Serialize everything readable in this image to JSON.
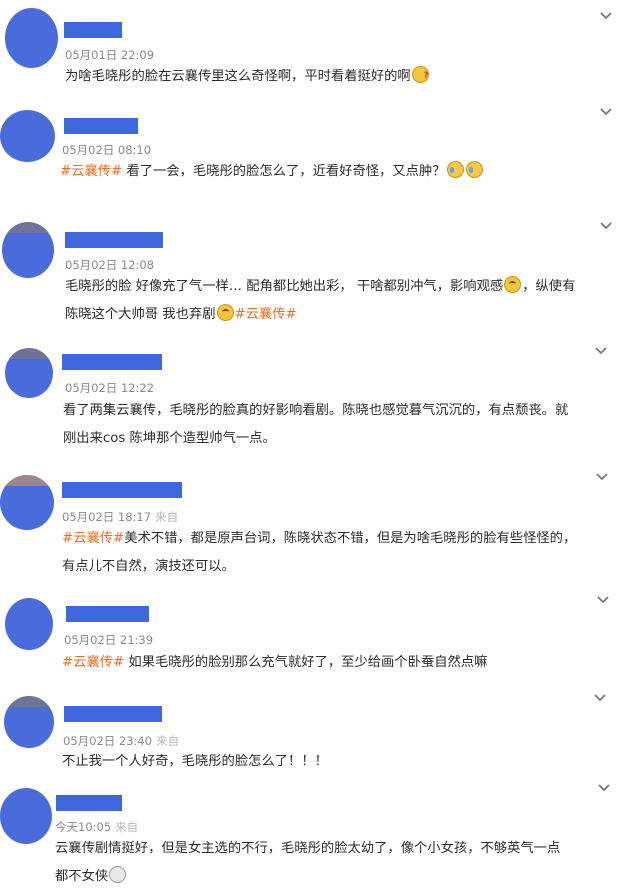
{
  "comments": [
    {
      "time": "05月01日 22:09",
      "source": "",
      "lines": [
        [
          {
            "t": "为啥毛晓彤的脸在云襄传里这么奇怪啊，平时看着挺好的啊"
          },
          {
            "emoji": "confused-face"
          }
        ]
      ]
    },
    {
      "time": "05月02日 08:10",
      "source": "",
      "lines": [
        [
          {
            "t": "#云襄传#",
            "tag": true
          },
          {
            "t": " 看了一会，毛晓彤的脸怎么了，近看好奇怪，又点肿？"
          },
          {
            "emoji": "crying-laughing-face"
          },
          {
            "emoji": "crying-laughing-face"
          }
        ]
      ]
    },
    {
      "time": "05月02日 12:08",
      "source": "",
      "lines": [
        [
          {
            "t": "毛晓彤的脸 好像充了气一样… 配角都比她出彩， 干啥都别冲气，影响观感"
          },
          {
            "emoji": "frowning-face"
          },
          {
            "t": "，纵使有"
          }
        ],
        [
          {
            "t": "陈晓这个大帅哥 我也弃剧"
          },
          {
            "emoji": "frowning-face"
          },
          {
            "t": "#云襄传#",
            "tag": true
          }
        ]
      ]
    },
    {
      "time": "05月02日 12:22",
      "source": "",
      "lines": [
        [
          {
            "t": "看了两集云襄传，毛晓彤的脸真的好影响看剧。陈晓也感觉暮气沉沉的，有点颓丧。就"
          }
        ],
        [
          {
            "t": "刚出来cos 陈坤那个造型帅气一点。"
          }
        ]
      ]
    },
    {
      "time": "05月02日 18:17",
      "source": "来自",
      "lines": [
        [
          {
            "t": "#云襄传#",
            "tag": true
          },
          {
            "t": "美术不错，都是原声台词，陈晓状态不错，但是为啥毛晓彤的脸有些怪怪的，"
          }
        ],
        [
          {
            "t": "有点儿不自然，演技还可以。"
          }
        ]
      ]
    },
    {
      "time": "05月02日 21:39",
      "source": "",
      "lines": [
        [
          {
            "t": "#云襄传#",
            "tag": true
          },
          {
            "t": " 如果毛晓彤的脸别那么充气就好了，至少给画个卧蚕自然点嘛"
          }
        ]
      ]
    },
    {
      "time": "05月02日 23:40",
      "source": "来自",
      "lines": [
        [
          {
            "t": "不止我一个人好奇，毛晓彤的脸怎么了！！！"
          }
        ]
      ]
    },
    {
      "time": "今天10:05",
      "source": "来自",
      "lines": [
        [
          {
            "t": "云襄传剧情挺好，但是女主选的不行，毛晓彤的脸太幼了，像个小女孩，不够英气一点"
          }
        ],
        [
          {
            "t": "都不女侠"
          },
          {
            "emoji": "shocked-face"
          }
        ]
      ]
    }
  ],
  "colors": {
    "tag": "#f36a1c",
    "avatar_redaction": "#4a6bdc",
    "name_redaction": "#3f68e0"
  }
}
